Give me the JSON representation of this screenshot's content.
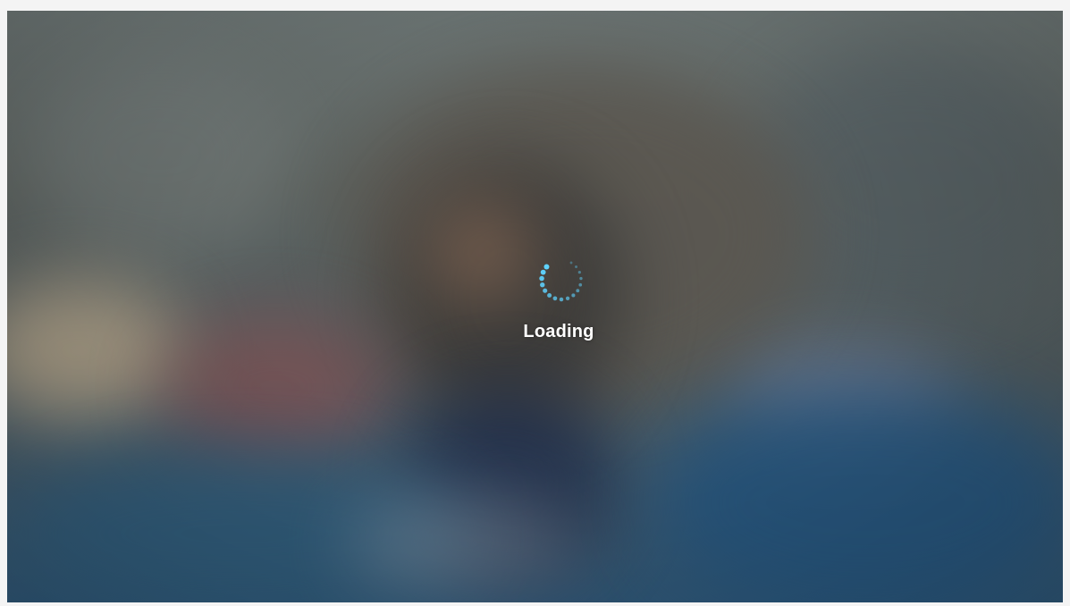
{
  "status": {
    "text": "Loading"
  },
  "spinner": {
    "icon": "spinner-icon",
    "dot_color": "#5fd3ff",
    "dot_count": 16
  },
  "colors": {
    "text": "#ffffff",
    "wallpaper_top": "#6a7372",
    "wallpaper_bottom": "#2f5777"
  }
}
